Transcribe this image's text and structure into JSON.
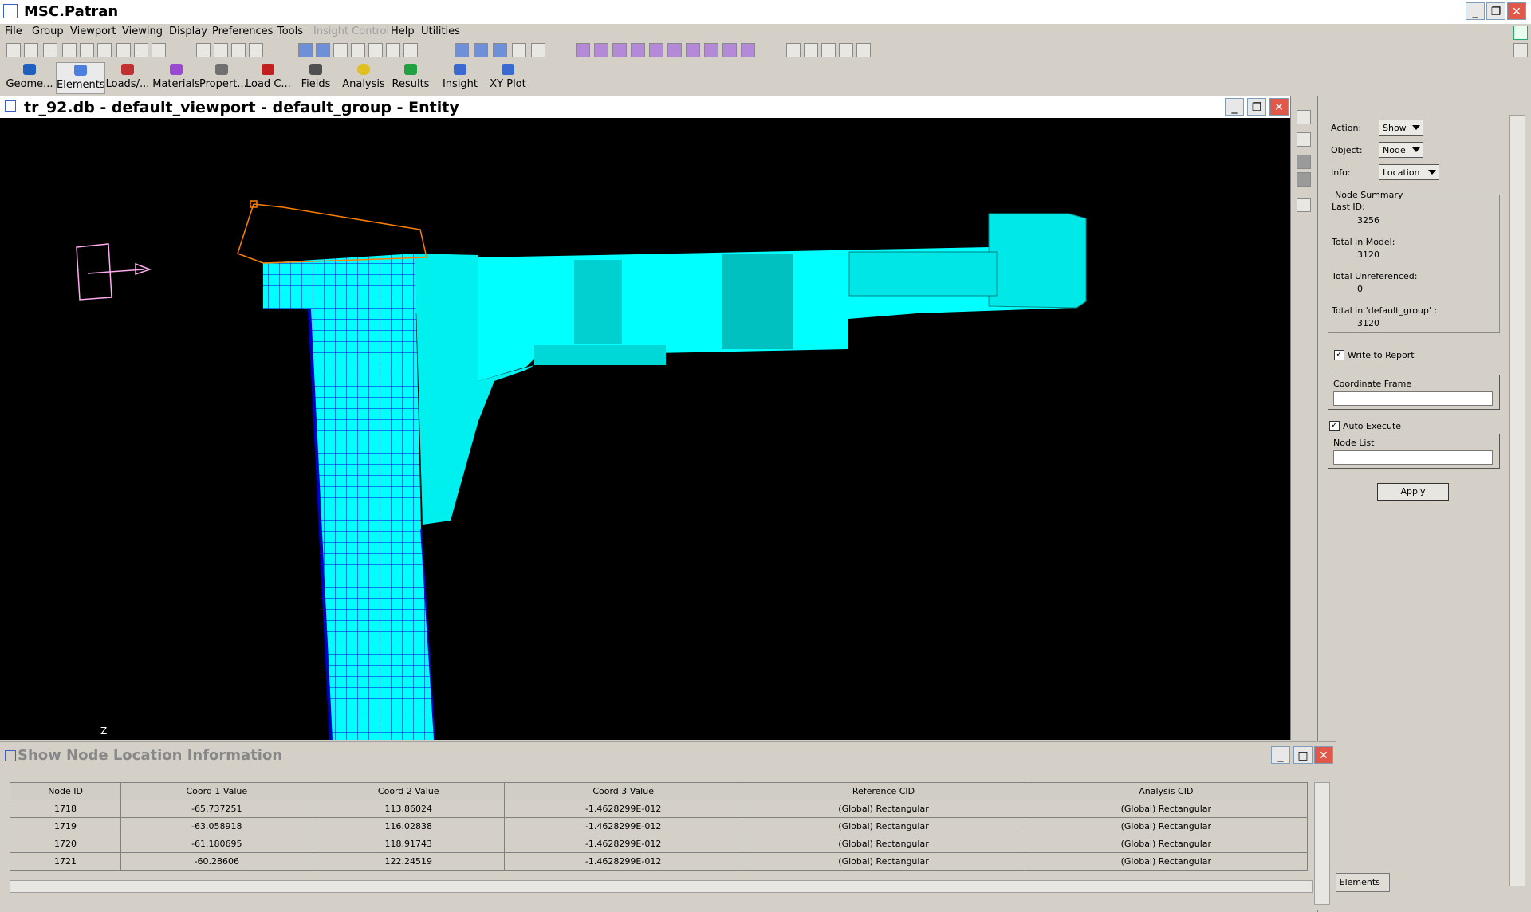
{
  "window": {
    "title": "MSC.Patran"
  },
  "menu": [
    "File",
    "Group",
    "Viewport",
    "Viewing",
    "Display",
    "Preferences",
    "Tools",
    "Insight Control",
    "Help",
    "Utilities"
  ],
  "app_tabs": [
    "Geome...",
    "Elements",
    "Loads/...",
    "Materials",
    "Propert...",
    "Load C...",
    "Fields",
    "Analysis",
    "Results",
    "Insight",
    "XY Plot"
  ],
  "viewport": {
    "title": "tr_92.db - default_viewport - default_group - Entity",
    "axis_label": "Z"
  },
  "panel": {
    "action_label": "Action:",
    "action_value": "Show",
    "object_label": "Object:",
    "object_value": "Node",
    "info_label": "Info:",
    "info_value": "Location",
    "summary_title": "Node Summary",
    "last_id_label": "Last ID:",
    "last_id_value": "3256",
    "total_model_label": "Total in Model:",
    "total_model_value": "3120",
    "total_unref_label": "Total Unreferenced:",
    "total_unref_value": "0",
    "total_group_label": "Total in 'default_group' :",
    "total_group_value": "3120",
    "write_report_label": "Write to Report",
    "coord_frame_label": "Coordinate Frame",
    "auto_execute_label": "Auto Execute",
    "node_list_label": "Node List",
    "apply_label": "Apply",
    "bottom_tab_label": "te Elements"
  },
  "dialog": {
    "title": "Show Node Location Information",
    "columns": [
      "Node ID",
      "Coord 1 Value",
      "Coord 2 Value",
      "Coord 3 Value",
      "Reference CID",
      "Analysis CID"
    ],
    "rows": [
      [
        "1718",
        "-65.737251",
        "113.86024",
        "-1.4628299E-012",
        "(Global) Rectangular",
        "(Global) Rectangular"
      ],
      [
        "1719",
        "-63.058918",
        "116.02838",
        "-1.4628299E-012",
        "(Global) Rectangular",
        "(Global) Rectangular"
      ],
      [
        "1720",
        "-61.180695",
        "118.91743",
        "-1.4628299E-012",
        "(Global) Rectangular",
        "(Global) Rectangular"
      ],
      [
        "1721",
        "-60.28606",
        "122.24519",
        "-1.4628299E-012",
        "(Global) Rectangular",
        "(Global) Rectangular"
      ]
    ]
  },
  "colors": {
    "model": "#00ffff",
    "mesh": "#0000c8",
    "background": "#000000"
  }
}
